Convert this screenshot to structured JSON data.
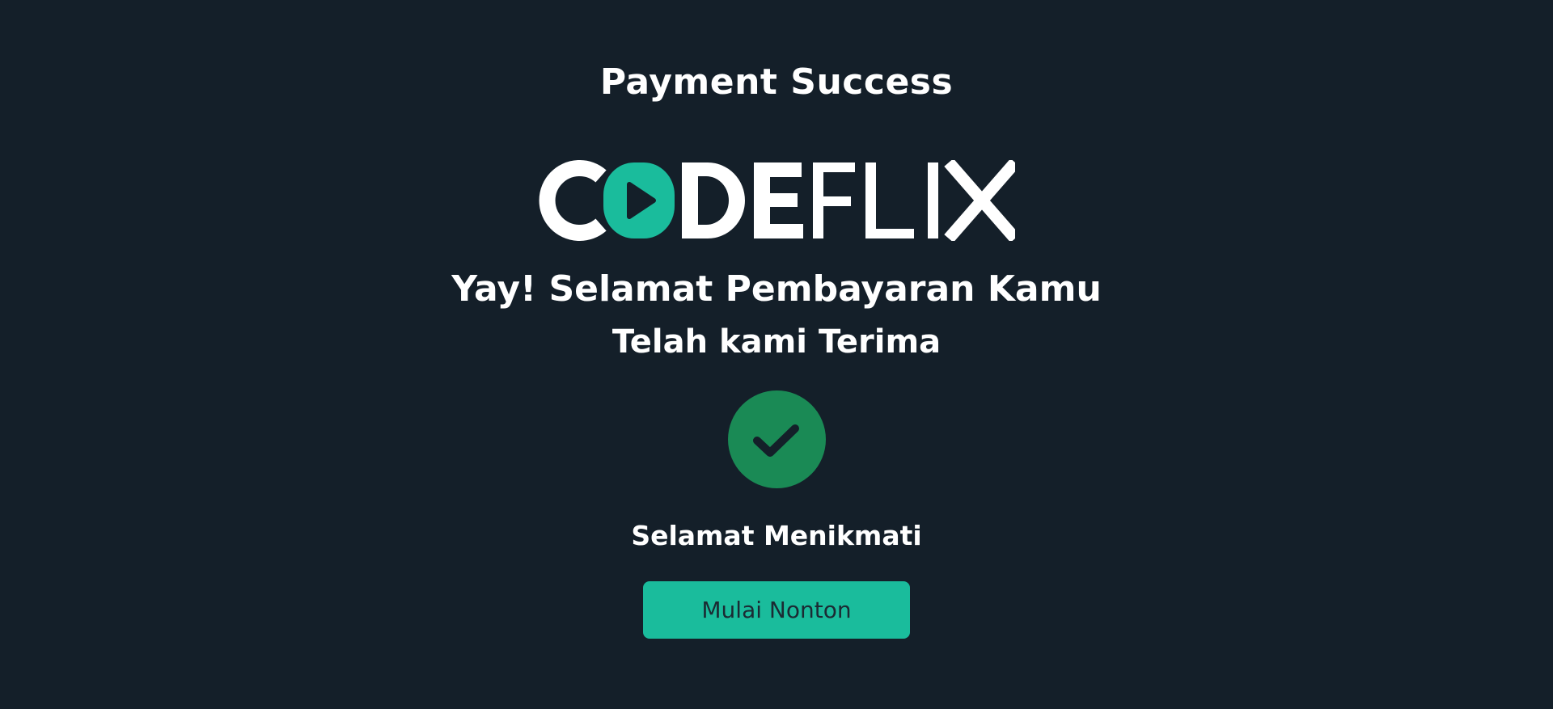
{
  "header": {
    "title": "Payment Success"
  },
  "brand": {
    "logo_text": "CODEFLIX",
    "logo_icon": "play-icon",
    "accent_color": "#1abc9c"
  },
  "message": {
    "line1": "Yay! Selamat Pembayaran Kamu",
    "line2": "Telah kami Terima"
  },
  "status": {
    "icon": "check-circle-icon",
    "color": "#1a8a55"
  },
  "footer": {
    "enjoy_text": "Selamat Menikmati",
    "cta_label": "Mulai Nonton"
  },
  "colors": {
    "background": "#141f29",
    "button": "#1abc9c",
    "text": "#ffffff"
  }
}
